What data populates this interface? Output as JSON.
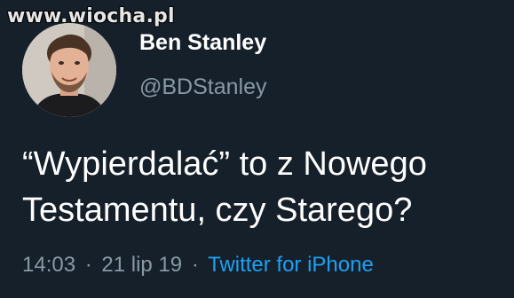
{
  "watermark": {
    "text": "www.wiocha.pl"
  },
  "user": {
    "display_name": "Ben Stanley",
    "handle": "@BDStanley"
  },
  "tweet": {
    "text_lines": [
      "“Wypierdalać” to z Nowego",
      "Testamentu, czy Starego?"
    ],
    "time": "14:03",
    "date": "21 lip 19",
    "separator": "·",
    "source": "Twitter for iPhone"
  },
  "colors": {
    "background": "#15202b",
    "text": "#ffffff",
    "muted": "#8899a6",
    "link": "#1da1f2"
  }
}
